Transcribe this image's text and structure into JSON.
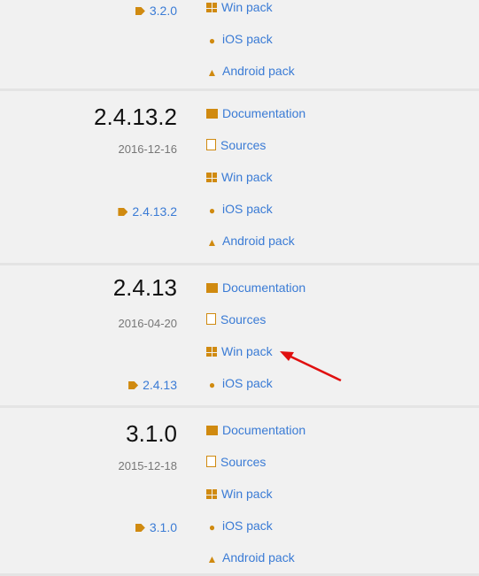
{
  "releases": [
    {
      "version": "",
      "date": "",
      "tag": "3.2.0",
      "links": [
        "Win pack",
        "iOS pack",
        "Android pack"
      ]
    },
    {
      "version": "2.4.13.2",
      "date": "2016-12-16",
      "tag": "2.4.13.2",
      "links": [
        "Documentation",
        "Sources",
        "Win pack",
        "iOS pack",
        "Android pack"
      ]
    },
    {
      "version": "2.4.13",
      "date": "2016-04-20",
      "tag": "2.4.13",
      "links": [
        "Documentation",
        "Sources",
        "Win pack",
        "iOS pack"
      ]
    },
    {
      "version": "3.1.0",
      "date": "2015-12-18",
      "tag": "3.1.0",
      "links": [
        "Documentation",
        "Sources",
        "Win pack",
        "iOS pack",
        "Android pack"
      ]
    }
  ],
  "icons": {
    "Documentation": "archive-icon",
    "Sources": "zip-file-icon",
    "Win pack": "windows-icon",
    "iOS pack": "apple-icon",
    "Android pack": "android-icon",
    "tag": "tag-icon"
  },
  "colors": {
    "link": "#3a7bd5",
    "icon": "#d08a10",
    "arrow": "#e01010"
  }
}
